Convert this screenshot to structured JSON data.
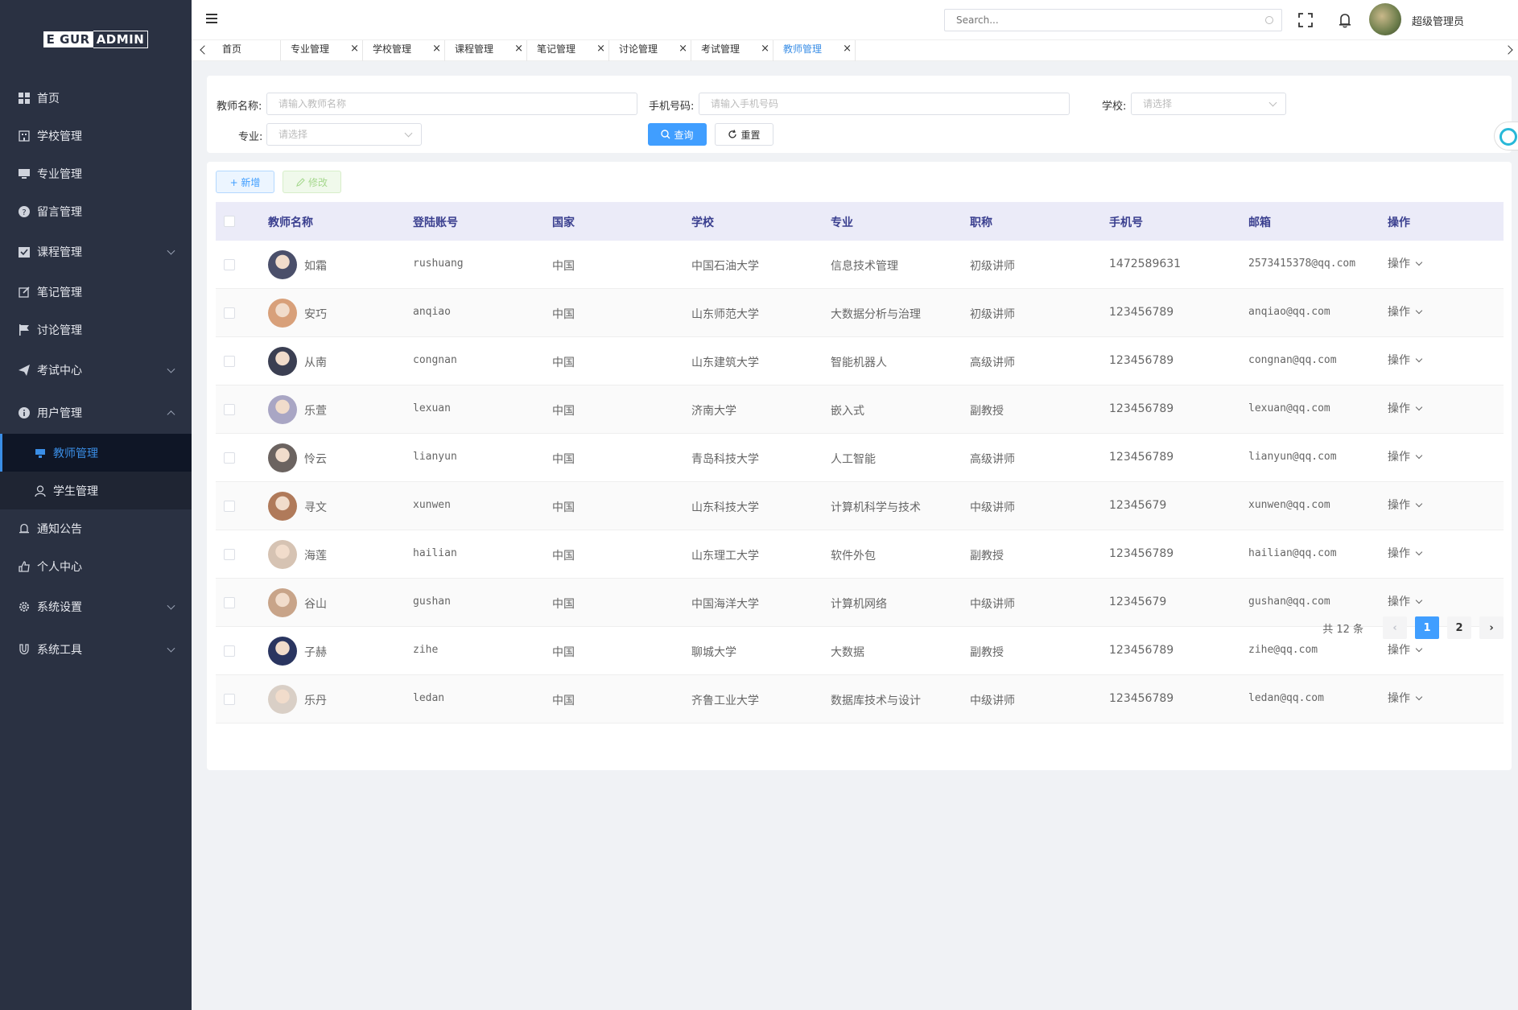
{
  "logo": {
    "part1": "E GUR",
    "part2": "ADMIN"
  },
  "sidebar": {
    "items": [
      {
        "label": "首页"
      },
      {
        "label": "学校管理"
      },
      {
        "label": "专业管理"
      },
      {
        "label": "留言管理"
      },
      {
        "label": "课程管理"
      },
      {
        "label": "笔记管理"
      },
      {
        "label": "讨论管理"
      },
      {
        "label": "考试中心"
      },
      {
        "label": "用户管理"
      },
      {
        "label": "教师管理"
      },
      {
        "label": "学生管理"
      },
      {
        "label": "通知公告"
      },
      {
        "label": "个人中心"
      },
      {
        "label": "系统设置"
      },
      {
        "label": "系统工具"
      }
    ]
  },
  "header": {
    "search_placeholder": "Search...",
    "user_name": "超级管理员"
  },
  "tabs": [
    {
      "label": "首页"
    },
    {
      "label": "专业管理"
    },
    {
      "label": "学校管理"
    },
    {
      "label": "课程管理"
    },
    {
      "label": "笔记管理"
    },
    {
      "label": "讨论管理"
    },
    {
      "label": "考试管理"
    },
    {
      "label": "教师管理"
    }
  ],
  "filters": {
    "name_label": "教师名称:",
    "name_placeholder": "请输入教师名称",
    "phone_label": "手机号码:",
    "phone_placeholder": "请输入手机号码",
    "school_label": "学校:",
    "school_placeholder": "请选择",
    "major_label": "专业:",
    "major_placeholder": "请选择",
    "query_btn": "查询",
    "reset_btn": "重置"
  },
  "toolbar": {
    "add_label": "+ 新增",
    "edit_label": "修改"
  },
  "table": {
    "headers": [
      "教师名称",
      "登陆账号",
      "国家",
      "学校",
      "专业",
      "职称",
      "手机号",
      "邮箱",
      "操作"
    ],
    "rows": [
      {
        "name": "如霜",
        "account": "rushuang",
        "country": "中国",
        "school": "中国石油大学",
        "major": "信息技术管理",
        "title": "初级讲师",
        "phone": "1472589631",
        "email": "2573415378@qq.com",
        "op": "操作"
      },
      {
        "name": "安巧",
        "account": "anqiao",
        "country": "中国",
        "school": "山东师范大学",
        "major": "大数据分析与治理",
        "title": "初级讲师",
        "phone": "123456789",
        "email": "anqiao@qq.com",
        "op": "操作"
      },
      {
        "name": "从南",
        "account": "congnan",
        "country": "中国",
        "school": "山东建筑大学",
        "major": "智能机器人",
        "title": "高级讲师",
        "phone": "123456789",
        "email": "congnan@qq.com",
        "op": "操作"
      },
      {
        "name": "乐萱",
        "account": "lexuan",
        "country": "中国",
        "school": "济南大学",
        "major": "嵌入式",
        "title": "副教授",
        "phone": "123456789",
        "email": "lexuan@qq.com",
        "op": "操作"
      },
      {
        "name": "怜云",
        "account": "lianyun",
        "country": "中国",
        "school": "青岛科技大学",
        "major": "人工智能",
        "title": "高级讲师",
        "phone": "123456789",
        "email": "lianyun@qq.com",
        "op": "操作"
      },
      {
        "name": "寻文",
        "account": "xunwen",
        "country": "中国",
        "school": "山东科技大学",
        "major": "计算机科学与技术",
        "title": "中级讲师",
        "phone": "12345679",
        "email": "xunwen@qq.com",
        "op": "操作"
      },
      {
        "name": "海莲",
        "account": "hailian",
        "country": "中国",
        "school": "山东理工大学",
        "major": "软件外包",
        "title": "副教授",
        "phone": "123456789",
        "email": "hailian@qq.com",
        "op": "操作"
      },
      {
        "name": "谷山",
        "account": "gushan",
        "country": "中国",
        "school": "中国海洋大学",
        "major": "计算机网络",
        "title": "中级讲师",
        "phone": "12345679",
        "email": "gushan@qq.com",
        "op": "操作"
      },
      {
        "name": "子赫",
        "account": "zihe",
        "country": "中国",
        "school": "聊城大学",
        "major": "大数据",
        "title": "副教授",
        "phone": "123456789",
        "email": "zihe@qq.com",
        "op": "操作"
      },
      {
        "name": "乐丹",
        "account": "ledan",
        "country": "中国",
        "school": "齐鲁工业大学",
        "major": "数据库技术与设计",
        "title": "中级讲师",
        "phone": "123456789",
        "email": "ledan@qq.com",
        "op": "操作"
      }
    ]
  },
  "pagination": {
    "total": "共 12 条",
    "page1": "1",
    "page2": "2"
  },
  "colors": {
    "sidebar_bg": "#2a3142",
    "accent": "#409eff",
    "header_row": "#ebebf8"
  }
}
